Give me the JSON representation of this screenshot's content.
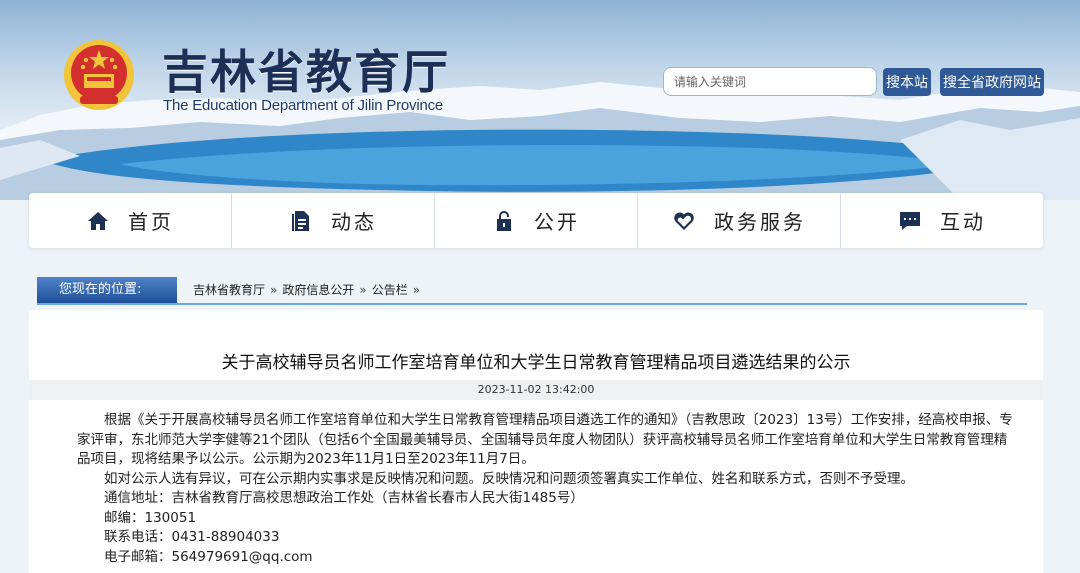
{
  "header": {
    "title": "吉林省教育厅",
    "subtitle": "The Education Department of Jilin Province",
    "search_placeholder": "请输入关键词",
    "search_site_label": "搜本站",
    "search_gov_label": "搜全省政府网站"
  },
  "nav": {
    "items": [
      {
        "label": "首页",
        "icon": "home-icon"
      },
      {
        "label": "动态",
        "icon": "document-icon"
      },
      {
        "label": "公开",
        "icon": "lock-icon"
      },
      {
        "label": "政务服务",
        "icon": "handshake-heart-icon"
      },
      {
        "label": "互动",
        "icon": "chat-icon"
      }
    ]
  },
  "breadcrumb": {
    "label": "您现在的位置:",
    "items": [
      "吉林省教育厅",
      "政府信息公开",
      "公告栏"
    ],
    "separator": "»"
  },
  "article": {
    "title": "关于高校辅导员名师工作室培育单位和大学生日常教育管理精品项目遴选结果的公示",
    "date": "2023-11-02 13:42:00",
    "paragraph1": "根据《关于开展高校辅导员名师工作室培育单位和大学生日常教育管理精品项目遴选工作的通知》（吉教思政〔2023〕13号）工作安排，经高校申报、专家评审，东北师范大学李健等21个团队（包括6个全国最美辅导员、全国辅导员年度人物团队）获评高校辅导员名师工作室培育单位和大学生日常教育管理精品项目，现将结果予以公示。公示期为2023年11月1日至2023年11月7日。",
    "paragraph2": "如对公示人选有异议，可在公示期内实事求是反映情况和问题。反映情况和问题须签署真实工作单位、姓名和联系方式，否则不予受理。",
    "address": "通信地址：吉林省教育厅高校思想政治工作处（吉林省长春市人民大街1485号）",
    "postcode": "邮编：130051",
    "phone": "联系电话：0431-88904033",
    "email": "电子邮箱：564979691@qq.com"
  },
  "colors": {
    "title_navy": "#1c2f57",
    "button_blue": "#2f5a97",
    "crumb_blue": "#1f4f9a",
    "accent_line": "#6fa8dc",
    "emblem_red": "#d32f2f",
    "emblem_gold": "#f2c43a"
  }
}
